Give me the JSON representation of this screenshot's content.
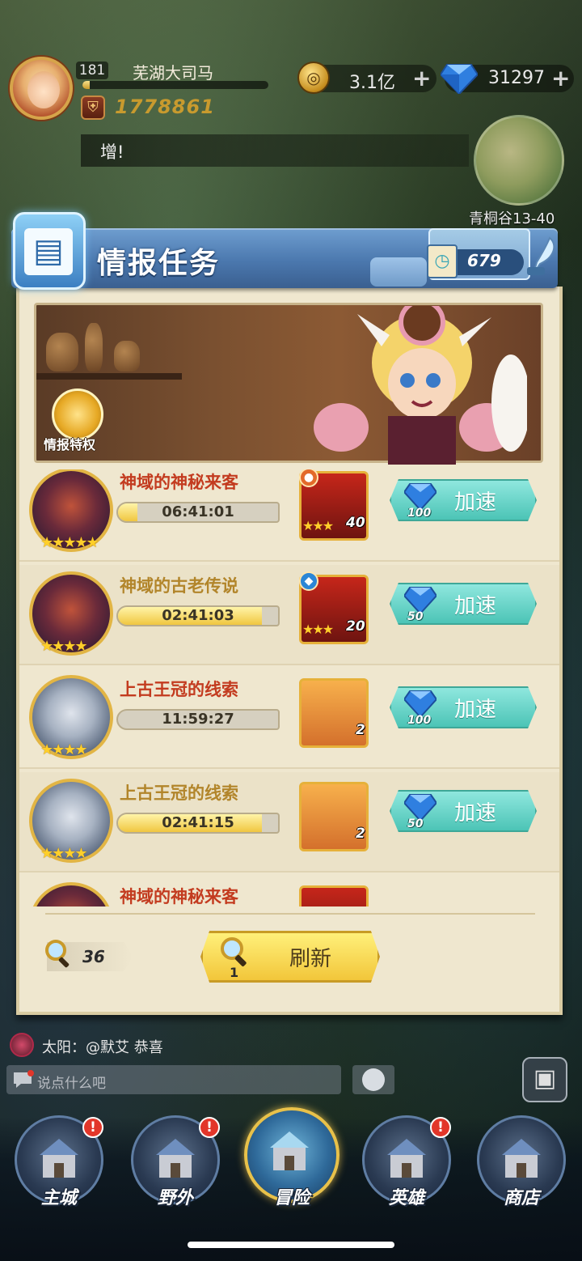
{
  "player": {
    "level": "181",
    "name": "芜湖大司马",
    "power": "1778861",
    "exp_progress": 0.04
  },
  "resources": {
    "gold": "3.1亿",
    "gems": "31297",
    "plus": "+"
  },
  "announcement": "增!",
  "minimap": {
    "label": "青桐谷13-40"
  },
  "panel": {
    "title": "情报任务",
    "intel_count": "679",
    "banner_badge": "情报特权",
    "speed_label": "加速",
    "search_count": "36",
    "refresh_label": "刷新",
    "refresh_cost": "1"
  },
  "tasks": [
    {
      "name": "神域的神秘来客",
      "timer": "06:41:01",
      "progress": 0.12,
      "portrait": "demon",
      "stars": "★★★★★",
      "reward_type": "hero",
      "reward_element": "fire",
      "reward_stars": "★★★",
      "reward_count": "40",
      "speed_cost": "100",
      "name_style": "red"
    },
    {
      "name": "神域的古老传说",
      "timer": "02:41:03",
      "progress": 0.9,
      "portrait": "demon",
      "stars": "★★★★",
      "reward_type": "hero",
      "reward_element": "water",
      "reward_stars": "★★★",
      "reward_count": "20",
      "speed_cost": "50",
      "name_style": "gold"
    },
    {
      "name": "上古王冠的线索",
      "timer": "11:59:27",
      "progress": 0.0,
      "portrait": "knight",
      "stars": "★★★★",
      "reward_type": "scroll",
      "reward_element": "",
      "reward_stars": "",
      "reward_count": "2",
      "speed_cost": "100",
      "name_style": "red"
    },
    {
      "name": "上古王冠的线索",
      "timer": "02:41:15",
      "progress": 0.9,
      "portrait": "knight",
      "stars": "★★★★",
      "reward_type": "scroll",
      "reward_element": "",
      "reward_stars": "",
      "reward_count": "2",
      "speed_cost": "50",
      "name_style": "gold"
    },
    {
      "name": "神域的神秘来客",
      "timer": "",
      "progress": 0.0,
      "portrait": "demon",
      "stars": "",
      "reward_type": "hero",
      "reward_element": "",
      "reward_stars": "",
      "reward_count": "",
      "speed_cost": "",
      "name_style": "red"
    }
  ],
  "chat": {
    "message": "太阳：@默艾 恭喜",
    "placeholder": "说点什么吧"
  },
  "nav": [
    {
      "label": "主城",
      "badge": "!"
    },
    {
      "label": "野外",
      "badge": "!"
    },
    {
      "label": "冒险",
      "badge": ""
    },
    {
      "label": "英雄",
      "badge": "!"
    },
    {
      "label": "商店",
      "badge": ""
    }
  ],
  "colors": {
    "accent_teal": "#4cc4b6",
    "accent_gold": "#f2c63a",
    "panel_bg": "#efe7cf",
    "header_blue": "#4b78ae"
  }
}
